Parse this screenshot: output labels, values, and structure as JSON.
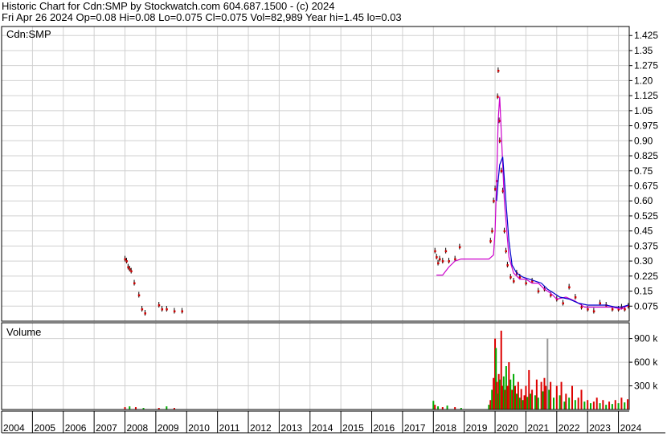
{
  "header": {
    "line1": "Historic Chart for Cdn:SMP by Stockwatch.com 604.687.1500 - (c) 2024",
    "line2": "Fri Apr 26 2024   Op=0.08   Hi=0.08   Lo=0.075   Cl=0.075   Vol=82,989   Year hi=1.45   lo=0.03"
  },
  "colors": {
    "frame": "#000000",
    "grid": "#d0d0d0",
    "price": "#000000",
    "close": "#cc0000",
    "ma_short": "#cc00cc",
    "ma_long": "#0000cc",
    "vol_up": "#00aa00",
    "vol_down": "#dd0000",
    "vol_flat": "#999999"
  },
  "chart_data": [
    {
      "type": "line",
      "title": "Cdn:SMP",
      "ylim": [
        0.0,
        1.47
      ],
      "yticks": [
        "1.425",
        "1.35",
        "1.275",
        "1.20",
        "1.125",
        "1.05",
        "0.975",
        "0.90",
        "0.825",
        "0.75",
        "0.675",
        "0.60",
        "0.525",
        "0.45",
        "0.375",
        "0.30",
        "0.225",
        "0.15",
        "0.075"
      ],
      "ytick_values": [
        1.425,
        1.35,
        1.275,
        1.2,
        1.125,
        1.05,
        0.975,
        0.9,
        0.825,
        0.75,
        0.675,
        0.6,
        0.525,
        0.45,
        0.375,
        0.3,
        0.225,
        0.15,
        0.075
      ],
      "xticks": [
        "2004",
        "2005",
        "2006",
        "2007",
        "2008",
        "2009",
        "2010",
        "2011",
        "2012",
        "2013",
        "2014",
        "2015",
        "2016",
        "2017",
        "2018",
        "2019",
        "2020",
        "2021",
        "2022",
        "2023",
        "2024"
      ],
      "xlim": [
        2004.0,
        2024.35
      ],
      "grid": true,
      "series": [
        {
          "kind": "close",
          "x": [
            2008.0,
            2008.05,
            2008.1,
            2008.15,
            2008.2,
            2008.3,
            2008.45,
            2008.55,
            2008.65,
            2009.1,
            2009.2,
            2009.35,
            2009.6,
            2009.85,
            2018.05,
            2018.1,
            2018.15,
            2018.2,
            2018.3,
            2018.4,
            2018.5,
            2018.7,
            2018.85,
            2019.85,
            2019.9,
            2019.95,
            2020.0,
            2020.05,
            2020.08,
            2020.1,
            2020.13,
            2020.15,
            2020.2,
            2020.25,
            2020.3,
            2020.35,
            2020.4,
            2020.5,
            2020.6,
            2020.7,
            2020.8,
            2021.0,
            2021.2,
            2021.4,
            2021.6,
            2021.8,
            2022.0,
            2022.2,
            2022.4,
            2022.6,
            2022.8,
            2023.0,
            2023.2,
            2023.4,
            2023.6,
            2023.8,
            2024.0,
            2024.1,
            2024.2,
            2024.32
          ],
          "y": [
            0.31,
            0.3,
            0.27,
            0.26,
            0.25,
            0.19,
            0.13,
            0.06,
            0.04,
            0.08,
            0.06,
            0.06,
            0.05,
            0.05,
            0.35,
            0.32,
            0.29,
            0.31,
            0.3,
            0.35,
            0.3,
            0.31,
            0.37,
            0.4,
            0.45,
            0.6,
            0.66,
            0.7,
            1.12,
            1.25,
            1.0,
            0.9,
            0.75,
            0.65,
            0.45,
            0.35,
            0.28,
            0.22,
            0.2,
            0.24,
            0.22,
            0.19,
            0.2,
            0.15,
            0.16,
            0.13,
            0.11,
            0.09,
            0.17,
            0.12,
            0.07,
            0.06,
            0.05,
            0.09,
            0.08,
            0.06,
            0.06,
            0.07,
            0.06,
            0.075
          ]
        },
        {
          "kind": "ma_short",
          "x": [
            2018.1,
            2018.3,
            2018.5,
            2018.7,
            2018.9,
            2019.2,
            2019.5,
            2019.8,
            2019.95,
            2020.0,
            2020.05,
            2020.1,
            2020.15,
            2020.2,
            2020.3,
            2020.45,
            2020.6,
            2020.8,
            2021.0,
            2021.2,
            2021.4,
            2021.6,
            2021.8,
            2022.0,
            2022.3,
            2022.6,
            2022.9,
            2023.2,
            2023.5,
            2023.8,
            2024.1,
            2024.32
          ],
          "y": [
            0.23,
            0.23,
            0.27,
            0.3,
            0.31,
            0.31,
            0.31,
            0.31,
            0.33,
            0.45,
            0.7,
            1.0,
            1.12,
            0.95,
            0.6,
            0.32,
            0.24,
            0.21,
            0.21,
            0.19,
            0.19,
            0.16,
            0.14,
            0.11,
            0.12,
            0.1,
            0.07,
            0.07,
            0.07,
            0.07,
            0.06,
            0.08
          ]
        },
        {
          "kind": "ma_long",
          "x": [
            2020.05,
            2020.1,
            2020.15,
            2020.25,
            2020.35,
            2020.45,
            2020.55,
            2020.7,
            2020.9,
            2021.1,
            2021.3,
            2021.5,
            2021.7,
            2021.9,
            2022.1,
            2022.4,
            2022.7,
            2023.0,
            2023.3,
            2023.6,
            2023.9,
            2024.1,
            2024.32
          ],
          "y": [
            0.6,
            0.7,
            0.78,
            0.82,
            0.6,
            0.4,
            0.28,
            0.24,
            0.22,
            0.21,
            0.2,
            0.19,
            0.16,
            0.14,
            0.12,
            0.11,
            0.09,
            0.08,
            0.08,
            0.08,
            0.07,
            0.07,
            0.08
          ]
        }
      ]
    },
    {
      "type": "bar",
      "title": "Volume",
      "ylim": [
        0,
        1100
      ],
      "yticks": [
        "900 k",
        "600 k",
        "300 k"
      ],
      "ytick_values": [
        900,
        600,
        300
      ],
      "grid": true,
      "bars": [
        {
          "x": 2008.0,
          "v": 30,
          "c": "down"
        },
        {
          "x": 2008.15,
          "v": 40,
          "c": "up"
        },
        {
          "x": 2008.35,
          "v": 30,
          "c": "down"
        },
        {
          "x": 2008.6,
          "v": 20,
          "c": "up"
        },
        {
          "x": 2009.1,
          "v": 20,
          "c": "down"
        },
        {
          "x": 2009.35,
          "v": 40,
          "c": "up"
        },
        {
          "x": 2009.6,
          "v": 20,
          "c": "down"
        },
        {
          "x": 2018.0,
          "v": 110,
          "c": "up"
        },
        {
          "x": 2018.05,
          "v": 60,
          "c": "down"
        },
        {
          "x": 2018.15,
          "v": 40,
          "c": "up"
        },
        {
          "x": 2018.3,
          "v": 30,
          "c": "down"
        },
        {
          "x": 2018.45,
          "v": 50,
          "c": "up"
        },
        {
          "x": 2018.7,
          "v": 30,
          "c": "down"
        },
        {
          "x": 2018.9,
          "v": 20,
          "c": "up"
        },
        {
          "x": 2019.8,
          "v": 60,
          "c": "up"
        },
        {
          "x": 2019.85,
          "v": 120,
          "c": "down"
        },
        {
          "x": 2019.9,
          "v": 250,
          "c": "up"
        },
        {
          "x": 2019.95,
          "v": 400,
          "c": "down"
        },
        {
          "x": 2020.0,
          "v": 900,
          "c": "down"
        },
        {
          "x": 2020.03,
          "v": 780,
          "c": "up"
        },
        {
          "x": 2020.06,
          "v": 350,
          "c": "down"
        },
        {
          "x": 2020.09,
          "v": 200,
          "c": "up"
        },
        {
          "x": 2020.12,
          "v": 450,
          "c": "down"
        },
        {
          "x": 2020.15,
          "v": 380,
          "c": "up"
        },
        {
          "x": 2020.2,
          "v": 1000,
          "c": "down"
        },
        {
          "x": 2020.24,
          "v": 300,
          "c": "down"
        },
        {
          "x": 2020.28,
          "v": 420,
          "c": "up"
        },
        {
          "x": 2020.32,
          "v": 250,
          "c": "down"
        },
        {
          "x": 2020.36,
          "v": 550,
          "c": "up"
        },
        {
          "x": 2020.4,
          "v": 300,
          "c": "down"
        },
        {
          "x": 2020.45,
          "v": 600,
          "c": "down"
        },
        {
          "x": 2020.5,
          "v": 380,
          "c": "up"
        },
        {
          "x": 2020.55,
          "v": 250,
          "c": "down"
        },
        {
          "x": 2020.6,
          "v": 450,
          "c": "up"
        },
        {
          "x": 2020.65,
          "v": 300,
          "c": "down"
        },
        {
          "x": 2020.7,
          "v": 200,
          "c": "up"
        },
        {
          "x": 2020.75,
          "v": 350,
          "c": "down"
        },
        {
          "x": 2020.8,
          "v": 150,
          "c": "up"
        },
        {
          "x": 2020.85,
          "v": 260,
          "c": "down"
        },
        {
          "x": 2020.9,
          "v": 120,
          "c": "up"
        },
        {
          "x": 2020.95,
          "v": 180,
          "c": "down"
        },
        {
          "x": 2021.0,
          "v": 300,
          "c": "down"
        },
        {
          "x": 2021.05,
          "v": 160,
          "c": "up"
        },
        {
          "x": 2021.1,
          "v": 500,
          "c": "down"
        },
        {
          "x": 2021.15,
          "v": 200,
          "c": "up"
        },
        {
          "x": 2021.2,
          "v": 250,
          "c": "down"
        },
        {
          "x": 2021.3,
          "v": 180,
          "c": "up"
        },
        {
          "x": 2021.35,
          "v": 380,
          "c": "down"
        },
        {
          "x": 2021.4,
          "v": 150,
          "c": "up"
        },
        {
          "x": 2021.5,
          "v": 350,
          "c": "down"
        },
        {
          "x": 2021.55,
          "v": 230,
          "c": "up"
        },
        {
          "x": 2021.6,
          "v": 400,
          "c": "down"
        },
        {
          "x": 2021.65,
          "v": 300,
          "c": "down"
        },
        {
          "x": 2021.7,
          "v": 900,
          "c": "flat"
        },
        {
          "x": 2021.75,
          "v": 250,
          "c": "up"
        },
        {
          "x": 2021.8,
          "v": 350,
          "c": "down"
        },
        {
          "x": 2021.9,
          "v": 150,
          "c": "up"
        },
        {
          "x": 2022.0,
          "v": 300,
          "c": "down"
        },
        {
          "x": 2022.1,
          "v": 180,
          "c": "up"
        },
        {
          "x": 2022.15,
          "v": 350,
          "c": "down"
        },
        {
          "x": 2022.25,
          "v": 100,
          "c": "up"
        },
        {
          "x": 2022.3,
          "v": 200,
          "c": "down"
        },
        {
          "x": 2022.4,
          "v": 150,
          "c": "up"
        },
        {
          "x": 2022.5,
          "v": 300,
          "c": "down"
        },
        {
          "x": 2022.6,
          "v": 120,
          "c": "up"
        },
        {
          "x": 2022.7,
          "v": 150,
          "c": "down"
        },
        {
          "x": 2022.8,
          "v": 250,
          "c": "down"
        },
        {
          "x": 2022.9,
          "v": 100,
          "c": "up"
        },
        {
          "x": 2023.0,
          "v": 120,
          "c": "down"
        },
        {
          "x": 2023.1,
          "v": 80,
          "c": "up"
        },
        {
          "x": 2023.2,
          "v": 100,
          "c": "down"
        },
        {
          "x": 2023.3,
          "v": 150,
          "c": "down"
        },
        {
          "x": 2023.4,
          "v": 80,
          "c": "up"
        },
        {
          "x": 2023.5,
          "v": 120,
          "c": "down"
        },
        {
          "x": 2023.6,
          "v": 60,
          "c": "up"
        },
        {
          "x": 2023.7,
          "v": 100,
          "c": "down"
        },
        {
          "x": 2023.8,
          "v": 70,
          "c": "up"
        },
        {
          "x": 2023.9,
          "v": 120,
          "c": "down"
        },
        {
          "x": 2024.0,
          "v": 80,
          "c": "up"
        },
        {
          "x": 2024.1,
          "v": 150,
          "c": "down"
        },
        {
          "x": 2024.2,
          "v": 90,
          "c": "up"
        },
        {
          "x": 2024.3,
          "v": 130,
          "c": "down"
        }
      ]
    }
  ]
}
